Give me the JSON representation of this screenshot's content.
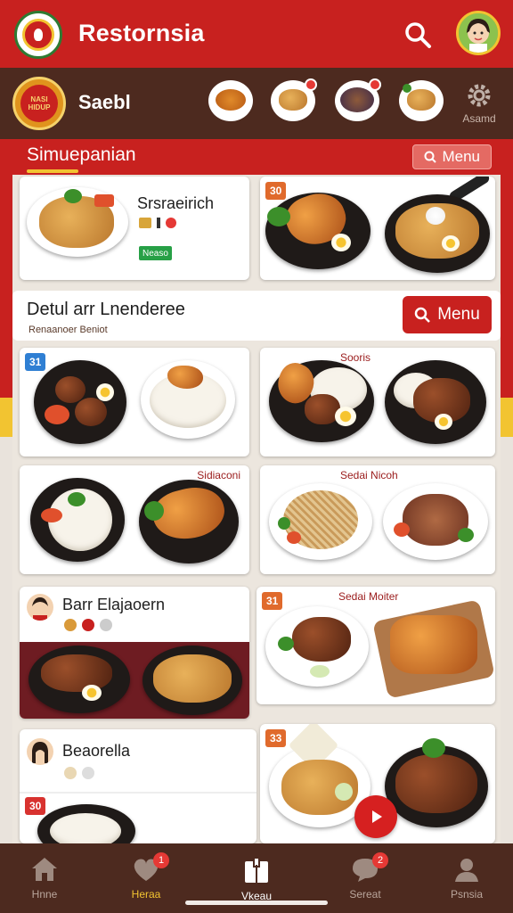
{
  "app": {
    "title": "Restornsia"
  },
  "subbar": {
    "badge_text": "NASI HIDUP",
    "label": "Saebl",
    "settings_label": "Asamd"
  },
  "section": {
    "title": "Simuepanian",
    "menu_chip": "Menu"
  },
  "cards_top": [
    {
      "title": "Srsraeirich",
      "badge": "Neaso"
    },
    {
      "tag": "30"
    }
  ],
  "feature": {
    "title": "Detul arr Lnenderee",
    "subtitle": "Renaanoer Beniot",
    "menu_button": "Menu"
  },
  "cards_mid": [
    {
      "tag": "31"
    },
    {
      "label": "Sooris"
    },
    {
      "label": "Sidiaconi"
    },
    {
      "label": "Sedai Nicoh"
    }
  ],
  "cards_low": [
    {
      "title": "Barr Elajaoern"
    },
    {
      "tag": "31",
      "label": "Sedai Moiter"
    },
    {
      "title": "Beaorella"
    },
    {
      "tag": "33",
      "tag2": "30"
    }
  ],
  "nav": [
    {
      "label": "Hnne",
      "icon": "home-icon"
    },
    {
      "label": "Heraa",
      "icon": "heart-icon",
      "badge": "1",
      "active": true
    },
    {
      "label": "Vkeau",
      "icon": "menu-book-icon"
    },
    {
      "label": "Sereat",
      "icon": "chat-icon",
      "badge": "2"
    },
    {
      "label": "Psnsia",
      "icon": "profile-icon"
    }
  ],
  "colors": {
    "primary": "#c8211f",
    "dark": "#4d2a1f",
    "accent": "#f2c431"
  }
}
